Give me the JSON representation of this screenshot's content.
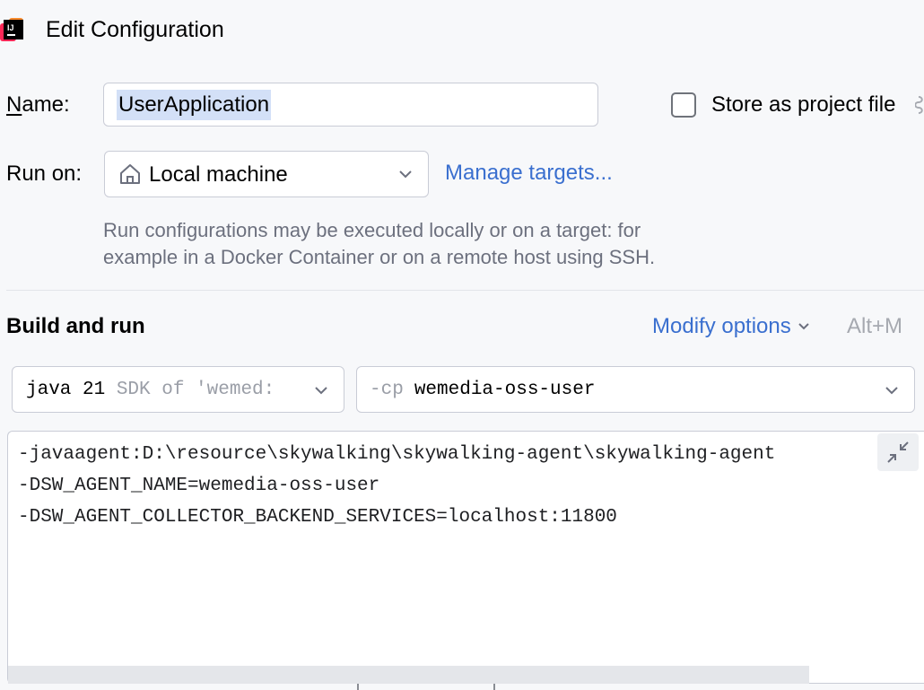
{
  "window": {
    "title": "Edit Configuration",
    "icon": "intellij-idea-logo-icon"
  },
  "name_row": {
    "label_mnemonic": "N",
    "label_rest": "ame:",
    "value": "UserApplication",
    "store_checkbox_checked": false,
    "store_label": "Store as project file"
  },
  "run_on": {
    "label": "Run on:",
    "value": "Local machine",
    "icon": "home-icon",
    "manage_link": "Manage targets...",
    "hint_line1": "Run configurations may be executed locally or on a target: for",
    "hint_line2": "example in a Docker Container or on a remote host using SSH."
  },
  "build_and_run": {
    "title": "Build and run",
    "modify_options": "Modify options",
    "modify_shortcut": "Alt+M",
    "jre": {
      "version": "java 21",
      "detail": "SDK of 'wemed:"
    },
    "classpath": {
      "flag": "-cp",
      "module": "wemedia-oss-user"
    },
    "vm_options": [
      "-javaagent:D:\\resource\\skywalking\\skywalking-agent\\skywalking-agent",
      "-DSW_AGENT_NAME=wemedia-oss-user",
      "-DSW_AGENT_COLLECTOR_BACKEND_SERVICES=localhost:11800"
    ]
  },
  "colors": {
    "background": "#f7f8fa",
    "link": "#3a6fcf",
    "selection": "#d3e0f7",
    "border": "#c9ccd6",
    "hint_text": "#6c707e"
  }
}
